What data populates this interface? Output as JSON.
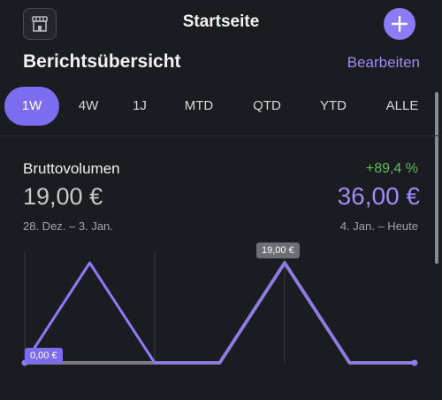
{
  "header": {
    "title": "Startseite",
    "store_icon": "storefront-icon",
    "add_icon": "plus-icon"
  },
  "report": {
    "title": "Berichtsübersicht",
    "edit_label": "Bearbeiten"
  },
  "tabs": [
    {
      "label": "1W",
      "active": true
    },
    {
      "label": "4W"
    },
    {
      "label": "1J"
    },
    {
      "label": "MTD"
    },
    {
      "label": "QTD"
    },
    {
      "label": "YTD"
    },
    {
      "label": "ALLE"
    }
  ],
  "metric": {
    "title": "Bruttovolumen",
    "change": "+89,4 %",
    "previous_value": "19,00 €",
    "current_value": "36,00 €",
    "previous_period": "28. Dez. – 3. Jan.",
    "current_period": "4. Jan. – Heute"
  },
  "chart_data": {
    "type": "line",
    "x": [
      1,
      2,
      3,
      4,
      5,
      6,
      7
    ],
    "series": [
      {
        "values": [
          0,
          19,
          0,
          0,
          19,
          0,
          0
        ],
        "color": "#8b7cf6"
      },
      {
        "values": [
          0,
          0,
          0,
          0,
          19,
          0,
          0
        ],
        "color": "#7a7a80"
      }
    ],
    "labels": {
      "max": "19,00 €",
      "min": "0,00 €"
    }
  },
  "colors": {
    "accent": "#8b7cf6",
    "positive": "#5fbe5a",
    "background": "#1b1c21"
  }
}
